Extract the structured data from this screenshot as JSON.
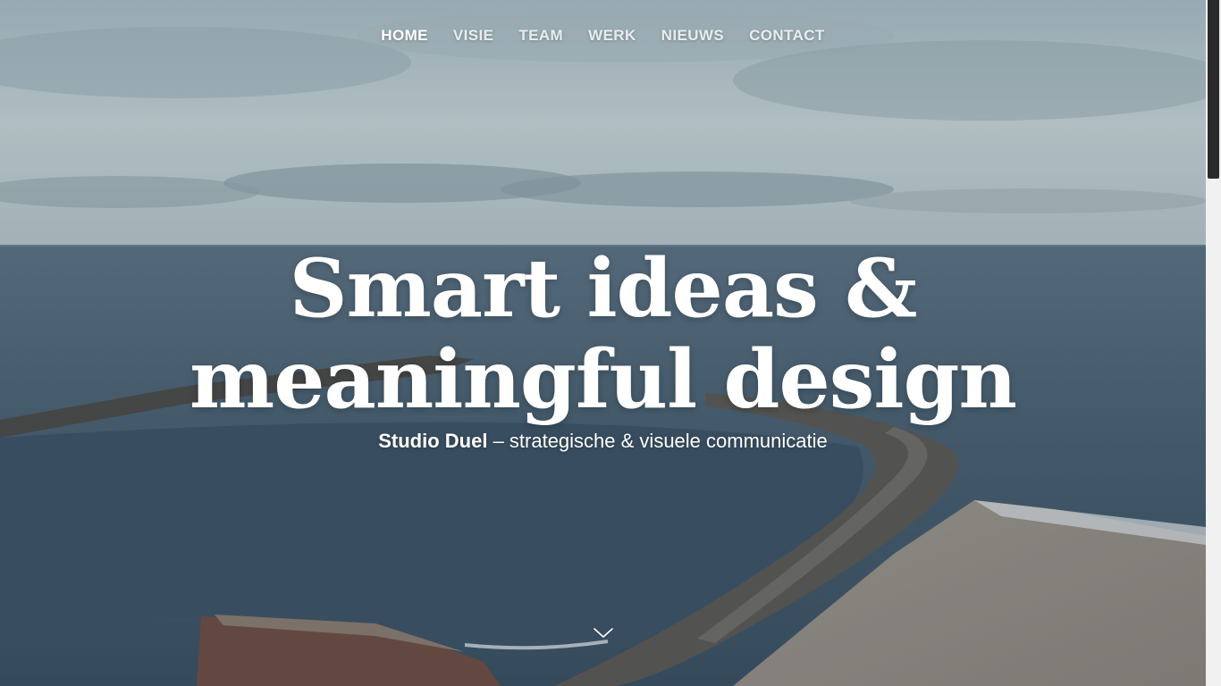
{
  "nav": {
    "items": [
      {
        "label": "HOME",
        "active": true
      },
      {
        "label": "VISIE",
        "active": false
      },
      {
        "label": "TEAM",
        "active": false
      },
      {
        "label": "WERK",
        "active": false
      },
      {
        "label": "NIEUWS",
        "active": false
      },
      {
        "label": "CONTACT",
        "active": false
      }
    ]
  },
  "hero": {
    "headline_line1": "Smart ideas &",
    "headline_line2": "meaningful design",
    "subtitle_brand": "Studio Duel",
    "subtitle_rest": " – strategische & visuele communicatie",
    "scroll_icon": "chevron-down-icon"
  },
  "colors": {
    "text": "#ffffff",
    "sky": "#c5d3d6",
    "sea": "#3c5264",
    "sand": "#a39a8f",
    "scroll_thumb": "#2a2a2a"
  }
}
